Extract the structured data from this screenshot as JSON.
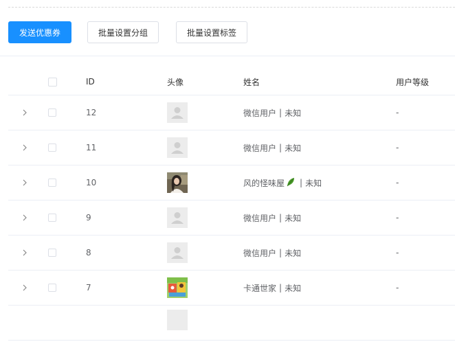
{
  "toolbar": {
    "send_coupon": "发送优惠券",
    "batch_group": "批量设置分组",
    "batch_tag": "批量设置标签"
  },
  "table": {
    "headers": {
      "id": "ID",
      "avatar": "头像",
      "name": "姓名",
      "level": "用户等级"
    },
    "rows": [
      {
        "id": "12",
        "name": "微信用户",
        "gender": "未知",
        "level": "-",
        "avatar": "placeholder-avatar"
      },
      {
        "id": "11",
        "name": "微信用户",
        "gender": "未知",
        "level": "-",
        "avatar": "placeholder-avatar"
      },
      {
        "id": "10",
        "name": "风的怪味屋",
        "gender": "未知",
        "level": "-",
        "avatar": "photo-avatar-girl"
      },
      {
        "id": "9",
        "name": "微信用户",
        "gender": "未知",
        "level": "-",
        "avatar": "placeholder-avatar"
      },
      {
        "id": "8",
        "name": "微信用户",
        "gender": "未知",
        "level": "-",
        "avatar": "placeholder-avatar"
      },
      {
        "id": "7",
        "name": "卡通世家",
        "gender": "未知",
        "level": "-",
        "avatar": "cartoon-avatar"
      }
    ],
    "name_separator": "|"
  },
  "colors": {
    "primary": "#1890ff",
    "border": "#ebeef5",
    "text": "#606266"
  },
  "icons": {
    "expand": "chevron-right-icon",
    "name_emoji": "leaf-icon"
  }
}
